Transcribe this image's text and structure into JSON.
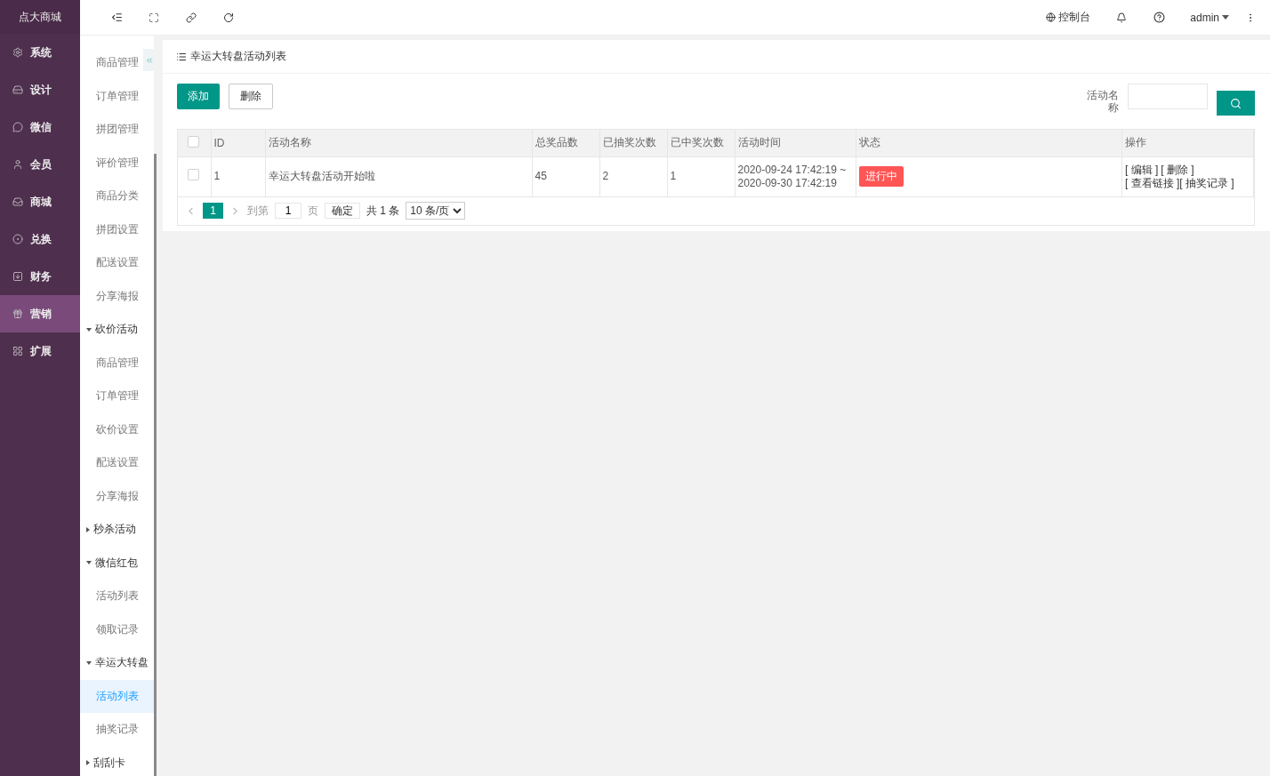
{
  "brand": "点大商城",
  "rail": [
    {
      "label": "系统",
      "selected": false
    },
    {
      "label": "设计",
      "selected": false
    },
    {
      "label": "微信",
      "selected": false
    },
    {
      "label": "会员",
      "selected": false
    },
    {
      "label": "商城",
      "selected": false
    },
    {
      "label": "兑换",
      "selected": false
    },
    {
      "label": "财务",
      "selected": false
    },
    {
      "label": "营销",
      "selected": true
    },
    {
      "label": "扩展",
      "selected": false
    }
  ],
  "topbar": {
    "console": "控制台",
    "user": "admin"
  },
  "submenu": [
    {
      "kind": "link",
      "label": "商品管理",
      "selected": false
    },
    {
      "kind": "link",
      "label": "订单管理",
      "selected": false
    },
    {
      "kind": "link",
      "label": "拼团管理",
      "selected": false
    },
    {
      "kind": "link",
      "label": "评价管理",
      "selected": false
    },
    {
      "kind": "link",
      "label": "商品分类",
      "selected": false
    },
    {
      "kind": "link",
      "label": "拼团设置",
      "selected": false
    },
    {
      "kind": "link",
      "label": "配送设置",
      "selected": false
    },
    {
      "kind": "link",
      "label": "分享海报",
      "selected": false
    },
    {
      "kind": "group",
      "label": "砍价活动",
      "expanded": true,
      "children": [
        {
          "label": "商品管理",
          "selected": false
        },
        {
          "label": "订单管理",
          "selected": false
        },
        {
          "label": "砍价设置",
          "selected": false
        },
        {
          "label": "配送设置",
          "selected": false
        },
        {
          "label": "分享海报",
          "selected": false
        }
      ]
    },
    {
      "kind": "group",
      "label": "秒杀活动",
      "expanded": false
    },
    {
      "kind": "group",
      "label": "微信红包",
      "expanded": true,
      "children": [
        {
          "label": "活动列表",
          "selected": false
        },
        {
          "label": "领取记录",
          "selected": false
        }
      ]
    },
    {
      "kind": "group",
      "label": "幸运大转盘",
      "expanded": true,
      "children": [
        {
          "label": "活动列表",
          "selected": true
        },
        {
          "label": "抽奖记录",
          "selected": false
        }
      ]
    },
    {
      "kind": "group",
      "label": "刮刮卡",
      "expanded": false
    }
  ],
  "card": {
    "title": "幸运大转盘活动列表",
    "buttons": [
      {
        "kind": "primary",
        "label": "添加"
      },
      {
        "kind": "plain",
        "label": "删除"
      }
    ],
    "search": {
      "label": "活动名称"
    },
    "table": {
      "all_checked": false,
      "columns": [
        "ID",
        "活动名称",
        "总奖品数",
        "已抽奖次数",
        "已中奖次数",
        "活动时间",
        "状态",
        "操作"
      ],
      "rows": [
        {
          "checked": false,
          "id": "1",
          "name": "幸运大转盘活动开始啦",
          "prizes": "45",
          "draws": "2",
          "wins": "1",
          "time_start": "2020-09-24 17:42:19 ~",
          "time_end": "2020-09-30 17:42:19",
          "status": {
            "text": "进行中",
            "color": "#ff5555"
          },
          "actions": [
            [
              "[ 编辑 ]",
              "[ 删除 ]"
            ],
            [
              "[ 查看链接 ]",
              "[ 抽奖记录 ]"
            ]
          ]
        }
      ]
    },
    "pagination": {
      "pages": [
        {
          "label": "1",
          "selected": true
        }
      ],
      "goto_label": "到第",
      "goto_value": "1",
      "page_unit": "页",
      "confirm": "确定",
      "total": "共 1 条",
      "page_size": "10 条/页"
    }
  }
}
